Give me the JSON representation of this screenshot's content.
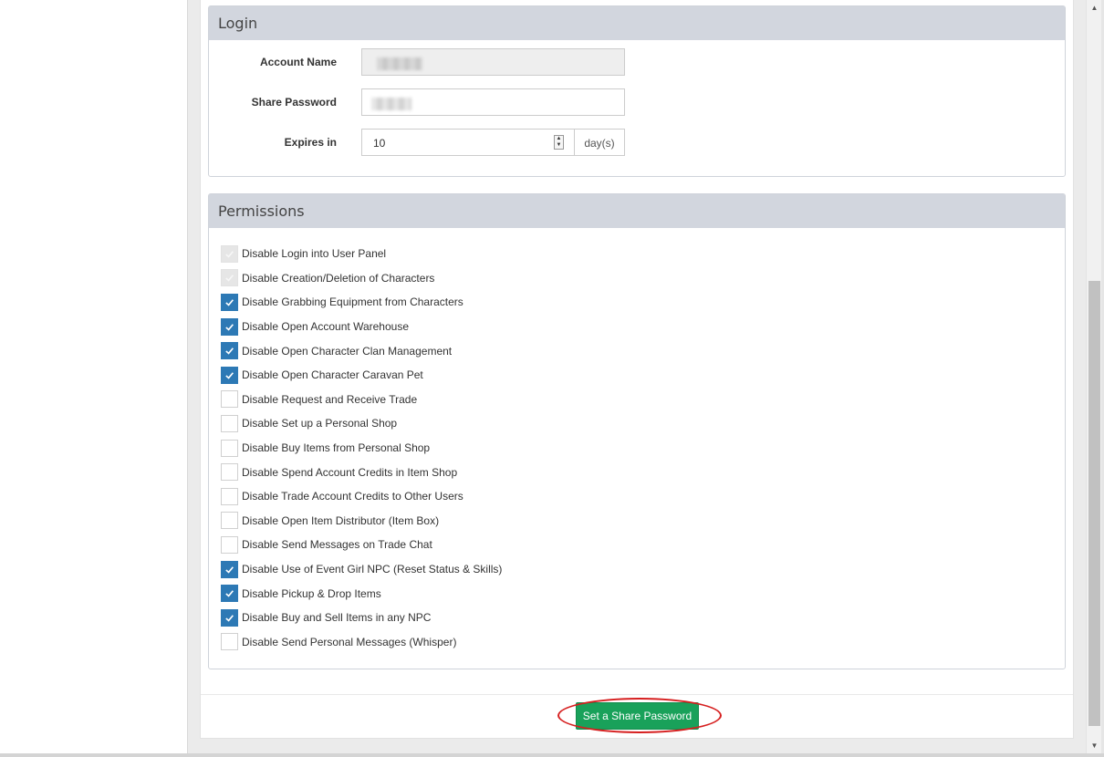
{
  "login": {
    "title": "Login",
    "account_name_label": "Account Name",
    "share_password_label": "Share Password",
    "expires_label": "Expires in",
    "expires_value": "10",
    "expires_unit": "day(s)"
  },
  "permissions": {
    "title": "Permissions",
    "items": [
      {
        "label": "Disable Login into User Panel",
        "state": "disabled-checked"
      },
      {
        "label": "Disable Creation/Deletion of Characters",
        "state": "disabled-checked"
      },
      {
        "label": "Disable Grabbing Equipment from Characters",
        "state": "checked"
      },
      {
        "label": "Disable Open Account Warehouse",
        "state": "checked"
      },
      {
        "label": "Disable Open Character Clan Management",
        "state": "checked"
      },
      {
        "label": "Disable Open Character Caravan Pet",
        "state": "checked"
      },
      {
        "label": "Disable Request and Receive Trade",
        "state": "unchecked"
      },
      {
        "label": "Disable Set up a Personal Shop",
        "state": "unchecked"
      },
      {
        "label": "Disable Buy Items from Personal Shop",
        "state": "unchecked"
      },
      {
        "label": "Disable Spend Account Credits in Item Shop",
        "state": "unchecked"
      },
      {
        "label": "Disable Trade Account Credits to Other Users",
        "state": "unchecked"
      },
      {
        "label": "Disable Open Item Distributor (Item Box)",
        "state": "unchecked"
      },
      {
        "label": "Disable Send Messages on Trade Chat",
        "state": "unchecked"
      },
      {
        "label": "Disable Use of Event Girl NPC (Reset Status & Skills)",
        "state": "checked"
      },
      {
        "label": "Disable Pickup & Drop Items",
        "state": "checked"
      },
      {
        "label": "Disable Buy and Sell Items in any NPC",
        "state": "checked"
      },
      {
        "label": "Disable Send Personal Messages (Whisper)",
        "state": "unchecked"
      }
    ]
  },
  "actions": {
    "submit_label": "Set a Share Password"
  },
  "colors": {
    "panel_heading": "#d2d6de",
    "checkbox_checked": "#2d79b5",
    "submit_button": "#19a15a",
    "annotation": "#d61f1f"
  }
}
